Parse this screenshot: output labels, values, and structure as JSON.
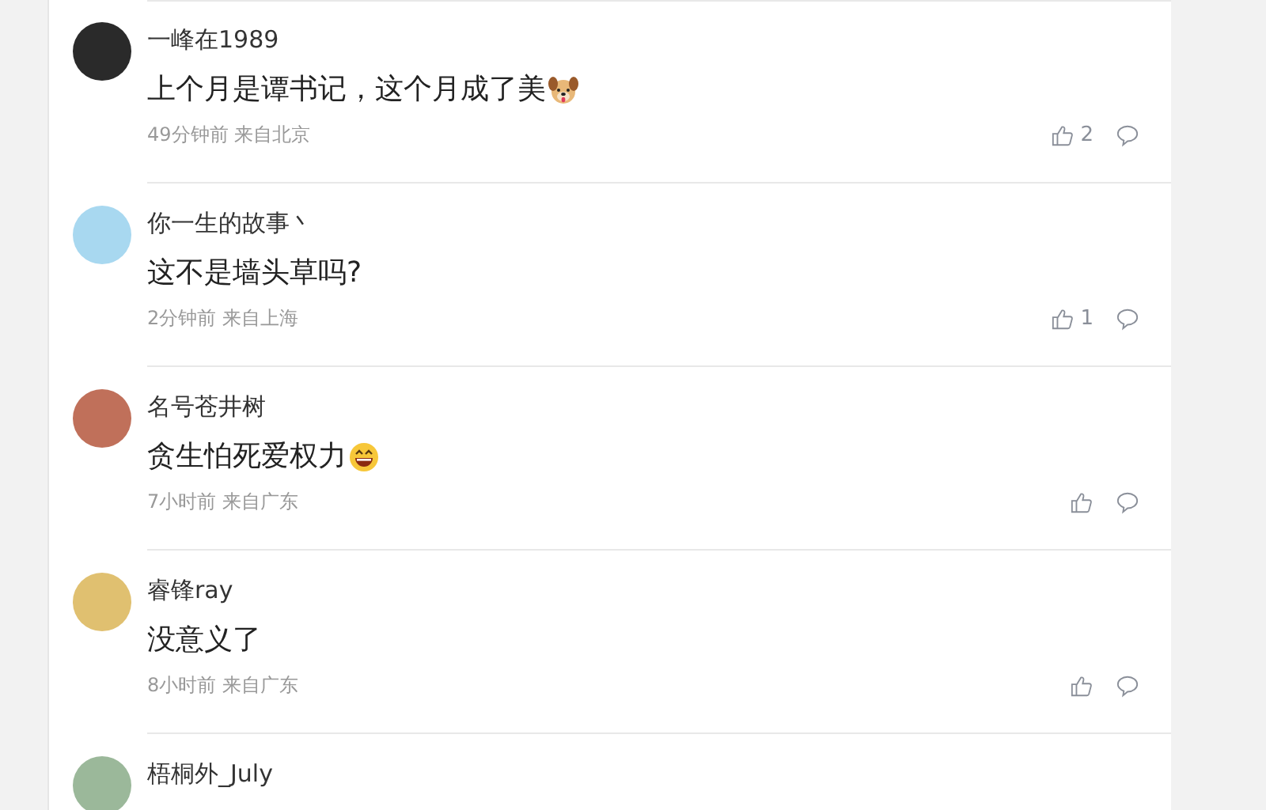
{
  "comments": [
    {
      "user": "一峰在1989",
      "color": "#2a2a2a",
      "text": "上个月是谭书记，这个月成了美",
      "emoji": {
        "kind": "dog"
      },
      "meta": "49分钟前 来自北京",
      "likes": "2"
    },
    {
      "user": "你一生的故事丶",
      "color": "#a8d8f0",
      "text": "这不是墙头草吗?",
      "meta": "2分钟前 来自上海",
      "likes": "1"
    },
    {
      "user": "名号苍井树",
      "color": "#c0705a",
      "text": "贪生怕死爱权力",
      "emoji": {
        "kind": "laugh"
      },
      "meta": "7小时前 来自广东"
    },
    {
      "user": "睿锋ray",
      "color": "#e0c070",
      "text": "没意义了",
      "meta": "8小时前 来自广东"
    },
    {
      "user": "梧桐外_July",
      "color": "#9bb89a"
    }
  ]
}
